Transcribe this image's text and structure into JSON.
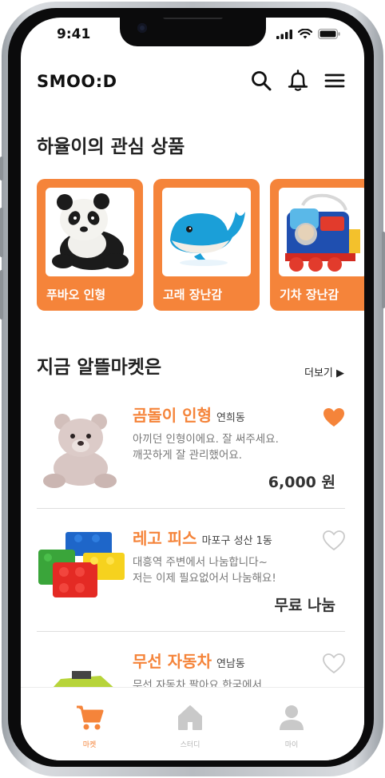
{
  "status_bar": {
    "time": "9:41"
  },
  "header": {
    "logo": "SMOO:D"
  },
  "interest": {
    "title": "하율이의 관심 상품",
    "items": [
      {
        "label": "푸바오 인형",
        "icon": "panda-plush"
      },
      {
        "label": "고래 장난감",
        "icon": "whale-toy"
      },
      {
        "label": "기차 장난감",
        "icon": "train-toy"
      }
    ]
  },
  "market": {
    "title": "지금 알뜰마켓은",
    "more_label": "더보기 ▶",
    "items": [
      {
        "title": "곰돌이 인형",
        "location": "연희동",
        "desc": "아끼던 인형이에요. 잘 써주세요.\n깨끗하게 잘 관리했어요.",
        "price": "6,000 원",
        "liked": true
      },
      {
        "title": "레고 피스",
        "location": "마포구 성산 1동",
        "desc": "대흥역 주변에서 나눔합니다~\n저는 이제 필요없어서 나눔해요!",
        "price": "무료 나눔",
        "liked": false
      },
      {
        "title": "무선 자동차",
        "location": "연남동",
        "desc": "무선 자동차 팔아요 한국에서",
        "price": "",
        "liked": false
      }
    ]
  },
  "tabbar": {
    "tabs": [
      {
        "label": "마켓",
        "icon": "cart-icon",
        "active": true
      },
      {
        "label": "스터디",
        "icon": "home-icon",
        "active": false
      },
      {
        "label": "마이",
        "icon": "person-icon",
        "active": false
      }
    ]
  },
  "colors": {
    "accent": "#f5843a",
    "text": "#222222",
    "inactive": "#c9c9c9"
  }
}
